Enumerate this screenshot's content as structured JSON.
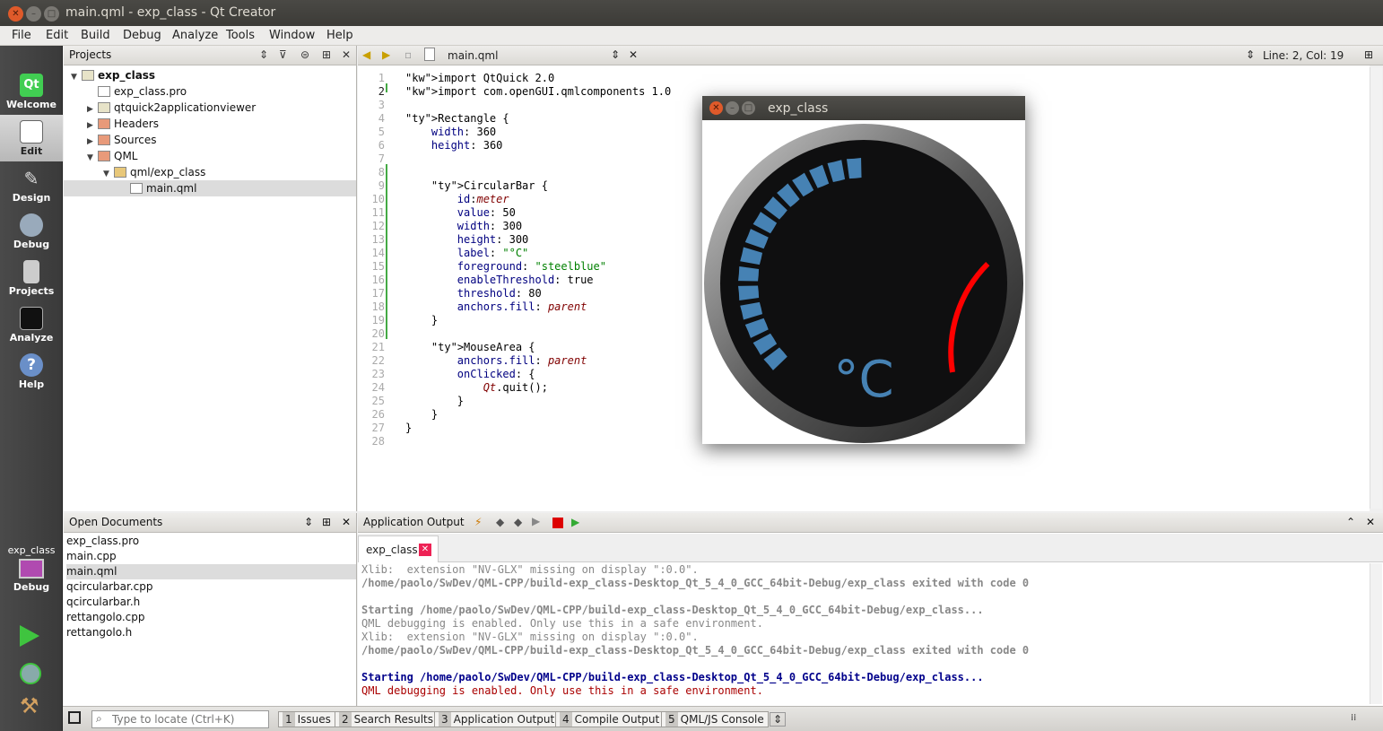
{
  "window": {
    "title": "main.qml - exp_class - Qt Creator"
  },
  "menu": [
    "File",
    "Edit",
    "Build",
    "Debug",
    "Analyze",
    "Tools",
    "Window",
    "Help"
  ],
  "modes": [
    {
      "label": "Welcome"
    },
    {
      "label": "Edit"
    },
    {
      "label": "Design"
    },
    {
      "label": "Debug"
    },
    {
      "label": "Projects"
    },
    {
      "label": "Analyze"
    },
    {
      "label": "Help"
    }
  ],
  "kit": {
    "project": "exp_class",
    "build": "Debug"
  },
  "projects": {
    "title": "Projects",
    "items": [
      {
        "label": "exp_class",
        "bold": true
      },
      {
        "label": "exp_class.pro"
      },
      {
        "label": "qtquick2applicationviewer"
      },
      {
        "label": "Headers"
      },
      {
        "label": "Sources"
      },
      {
        "label": "QML"
      },
      {
        "label": "qml/exp_class"
      },
      {
        "label": "main.qml"
      }
    ]
  },
  "editor": {
    "file": "main.qml",
    "position": "Line: 2, Col: 19"
  },
  "code": [
    "import QtQuick 2.0",
    "import com.openGUI.qmlcomponents 1.0",
    "",
    "Rectangle {",
    "    width: 360",
    "    height: 360",
    "",
    "",
    "    CircularBar {",
    "        id:meter",
    "        value: 50",
    "        width: 300",
    "        height: 300",
    "        label: \"°C\"",
    "        foreground: \"steelblue\"",
    "        enableThreshold: true",
    "        threshold: 80",
    "        anchors.fill: parent",
    "    }",
    "",
    "    MouseArea {",
    "        anchors.fill: parent",
    "        onClicked: {",
    "            Qt.quit();",
    "        }",
    "    }",
    "}",
    ""
  ],
  "open_documents": {
    "title": "Open Documents",
    "items": [
      "exp_class.pro",
      "main.cpp",
      "main.qml",
      "qcircularbar.cpp",
      "qcircularbar.h",
      "rettangolo.cpp",
      "rettangolo.h"
    ]
  },
  "output": {
    "title": "Application Output",
    "tab": "exp_class",
    "lines": [
      {
        "t": "Xlib:  extension \"NV-GLX\" missing on display \":0.0\".",
        "c": "#888",
        "b": false
      },
      {
        "t": "/home/paolo/SwDev/QML-CPP/build-exp_class-Desktop_Qt_5_4_0_GCC_64bit-Debug/exp_class exited with code 0",
        "c": "#888",
        "b": true
      },
      {
        "t": "",
        "c": "#888",
        "b": false
      },
      {
        "t": "Starting /home/paolo/SwDev/QML-CPP/build-exp_class-Desktop_Qt_5_4_0_GCC_64bit-Debug/exp_class...",
        "c": "#888",
        "b": true
      },
      {
        "t": "QML debugging is enabled. Only use this in a safe environment.",
        "c": "#888",
        "b": false
      },
      {
        "t": "Xlib:  extension \"NV-GLX\" missing on display \":0.0\".",
        "c": "#888",
        "b": false
      },
      {
        "t": "/home/paolo/SwDev/QML-CPP/build-exp_class-Desktop_Qt_5_4_0_GCC_64bit-Debug/exp_class exited with code 0",
        "c": "#888",
        "b": true
      },
      {
        "t": "",
        "c": "#888",
        "b": false
      },
      {
        "t": "Starting /home/paolo/SwDev/QML-CPP/build-exp_class-Desktop_Qt_5_4_0_GCC_64bit-Debug/exp_class...",
        "c": "#00008b",
        "b": true
      },
      {
        "t": "QML debugging is enabled. Only use this in a safe environment.",
        "c": "#aa0000",
        "b": false
      }
    ]
  },
  "status": {
    "locate_placeholder": "Type to locate (Ctrl+K)",
    "panes": [
      {
        "n": "1",
        "label": "Issues"
      },
      {
        "n": "2",
        "label": "Search Results"
      },
      {
        "n": "3",
        "label": "Application Output"
      },
      {
        "n": "4",
        "label": "Compile Output"
      },
      {
        "n": "5",
        "label": "QML/JS Console"
      }
    ]
  },
  "app": {
    "title": "exp_class",
    "unit": "°C",
    "value": 50,
    "threshold": 80,
    "foreground": "#4682b4",
    "threshold_color": "#ff0000"
  }
}
